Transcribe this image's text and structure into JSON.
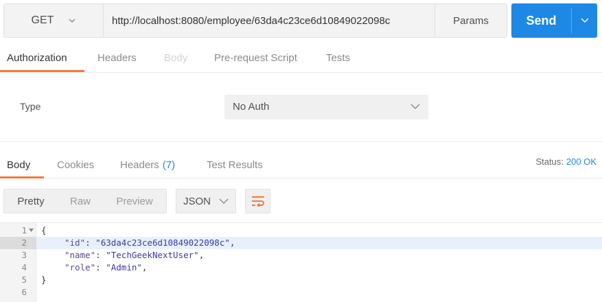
{
  "request": {
    "method": "GET",
    "url": "http://localhost:8080/employee/63da4c23ce6d10849022098c",
    "params_label": "Params",
    "send_label": "Send"
  },
  "request_tabs": [
    {
      "label": "Authorization",
      "state": "active"
    },
    {
      "label": "Headers",
      "state": "normal"
    },
    {
      "label": "Body",
      "state": "disabled"
    },
    {
      "label": "Pre-request Script",
      "state": "normal"
    },
    {
      "label": "Tests",
      "state": "normal"
    }
  ],
  "auth": {
    "type_label": "Type",
    "type_value": "No Auth"
  },
  "response_tabs": [
    {
      "label": "Body",
      "state": "active"
    },
    {
      "label": "Cookies",
      "state": "normal"
    },
    {
      "label": "Headers",
      "count": "(7)",
      "state": "normal"
    },
    {
      "label": "Test Results",
      "state": "normal"
    }
  ],
  "status": {
    "label": "Status:",
    "value": "200 OK"
  },
  "view": {
    "pretty": "Pretty",
    "raw": "Raw",
    "preview": "Preview",
    "format": "JSON"
  },
  "response_body": {
    "lines": [
      {
        "number": "1",
        "open": "{"
      },
      {
        "number": "2",
        "key": "\"id\"",
        "sep": ": ",
        "value": "\"63da4c23ce6d10849022098c\"",
        "tail": ","
      },
      {
        "number": "3",
        "key": "\"name\"",
        "sep": ": ",
        "value": "\"TechGeekNextUser\"",
        "tail": ","
      },
      {
        "number": "4",
        "key": "\"role\"",
        "sep": ": ",
        "value": "\"Admin\"",
        "tail": ","
      },
      {
        "number": "5",
        "close": "}"
      },
      {
        "number": "6"
      }
    ]
  },
  "colors": {
    "accent": "#f37b3a",
    "send_button": "#1e88e5",
    "link_blue": "#1e88e5"
  },
  "icons": [
    "chevron-down-icon",
    "wrap-lines-icon",
    "fold-arrow-icon"
  ]
}
